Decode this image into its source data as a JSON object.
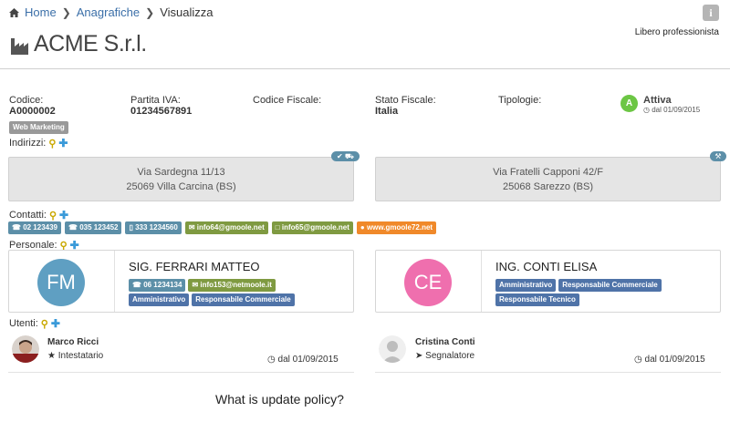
{
  "breadcrumb": {
    "home": "Home",
    "anagrafiche": "Anagrafiche",
    "current": "Visualizza"
  },
  "header": {
    "company": "ACME S.r.l.",
    "subtitle": "Libero professionista",
    "info_icon": "i"
  },
  "fields": {
    "codice": {
      "label": "Codice:",
      "value": "A0000002"
    },
    "partita_iva": {
      "label": "Partita IVA:",
      "value": "01234567891"
    },
    "codice_fiscale": {
      "label": "Codice Fiscale:",
      "value": ""
    },
    "stato_fiscale": {
      "label": "Stato Fiscale:",
      "value": "Italia"
    },
    "tipologie": {
      "label": "Tipologie:",
      "value": ""
    }
  },
  "tag": "Web Marketing",
  "status": {
    "letter": "A",
    "title": "Attiva",
    "since": "dal 01/09/2015",
    "color": "#6cc644"
  },
  "indirizzi": {
    "label": "Indirizzi:",
    "items": [
      {
        "line1": "Via Sardegna 11/13",
        "line2": "25069 Villa Carcina (BS)"
      },
      {
        "line1": "Via Fratelli Capponi 42/F",
        "line2": "25068 Sarezzo (BS)"
      }
    ]
  },
  "contatti": {
    "label": "Contatti:",
    "items": [
      {
        "icon": "phone-icon",
        "text": "02 123439",
        "color": "#5c8fa8"
      },
      {
        "icon": "phone-icon",
        "text": "035 123452",
        "color": "#5c8fa8"
      },
      {
        "icon": "mobile-icon",
        "text": "333 1234560",
        "color": "#5c8fa8"
      },
      {
        "icon": "mail-icon",
        "text": "info64@gmoole.net",
        "color": "#7f9a41"
      },
      {
        "icon": "mail-icon",
        "text": "info65@gmoole.net",
        "color": "#7f9a41"
      },
      {
        "icon": "globe-icon",
        "text": "www.gmoole72.net",
        "color": "#f0892a"
      }
    ]
  },
  "personale": {
    "label": "Personale:",
    "items": [
      {
        "initials": "FM",
        "avatar_color": "#5f9fc2",
        "name": "SIG. FERRARI MATTEO",
        "phone": "06 1234134",
        "email": "info153@netmoole.it",
        "roles": [
          "Amministrativo",
          "Responsabile Commerciale"
        ]
      },
      {
        "initials": "CE",
        "avatar_color": "#ef6fae",
        "name": "ING. CONTI ELISA",
        "roles": [
          "Amministrativo",
          "Responsabile Commerciale",
          "Responsabile Tecnico"
        ]
      }
    ]
  },
  "utenti": {
    "label": "Utenti:",
    "items": [
      {
        "name": "Marco Ricci",
        "role": "Intestatario",
        "since": "dal 01/09/2015"
      },
      {
        "name": "Cristina Conti",
        "role": "Segnalatore",
        "since": "dal 01/09/2015"
      }
    ]
  },
  "policy_question": "What is update policy?"
}
